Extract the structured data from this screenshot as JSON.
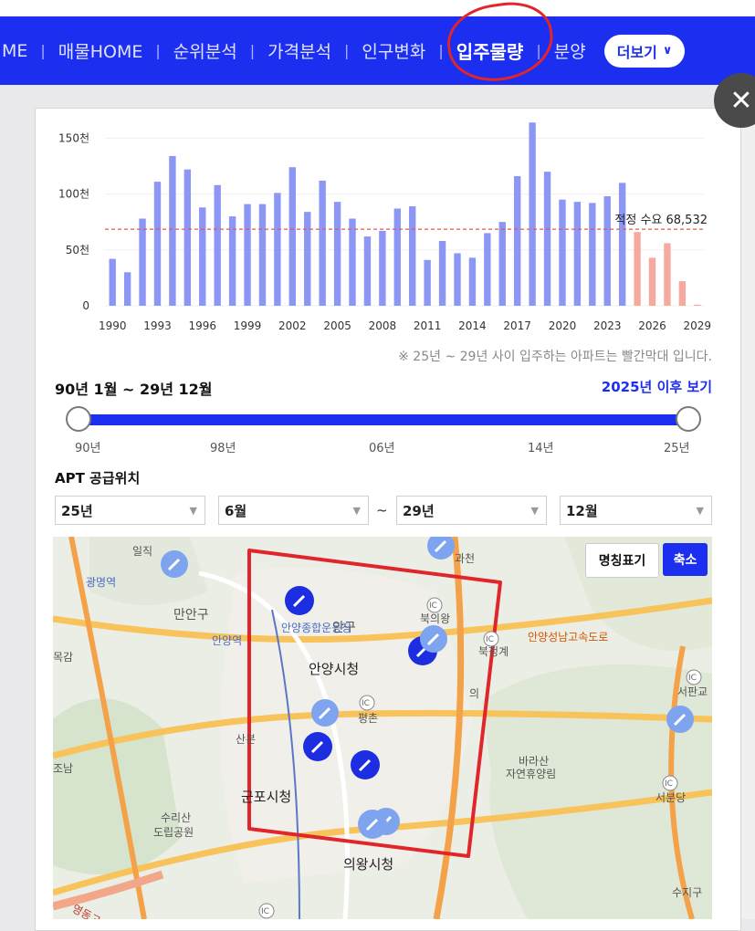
{
  "nav": {
    "items": [
      "ME",
      "매물HOME",
      "순위분석",
      "가격분석",
      "인구변화",
      "입주물량",
      "분양"
    ],
    "active_index": 5,
    "more_label": "더보기",
    "bg_color": "#1c2ef0"
  },
  "close_icon": "close-icon",
  "chart_data": {
    "type": "bar",
    "x": [
      1990,
      1991,
      1992,
      1993,
      1994,
      1995,
      1996,
      1997,
      1998,
      1999,
      2000,
      2001,
      2002,
      2003,
      2004,
      2005,
      2006,
      2007,
      2008,
      2009,
      2010,
      2011,
      2012,
      2013,
      2014,
      2015,
      2016,
      2017,
      2018,
      2019,
      2020,
      2021,
      2022,
      2023,
      2024,
      2025,
      2026,
      2027,
      2028,
      2029
    ],
    "values": [
      42,
      30,
      78,
      111,
      134,
      122,
      88,
      108,
      80,
      91,
      91,
      101,
      124,
      84,
      112,
      93,
      78,
      62,
      67,
      87,
      89,
      41,
      58,
      47,
      43,
      65,
      75,
      116,
      164,
      120,
      95,
      93,
      92,
      98,
      110,
      66,
      43,
      56,
      22,
      1
    ],
    "highlight_from": 2025,
    "bar_color": "#8c96f5",
    "highlight_color": "#f5aaa0",
    "ylim": [
      0,
      165
    ],
    "yticks": [
      0,
      50,
      100,
      150
    ],
    "ytick_labels": [
      "0",
      "50천",
      "100천",
      "150천"
    ],
    "xtick_labels": [
      "1990",
      "1993",
      "1996",
      "1999",
      "2002",
      "2005",
      "2008",
      "2011",
      "2014",
      "2017",
      "2020",
      "2023",
      "2026",
      "2029"
    ],
    "reference_line": {
      "value": 68532,
      "label": "적정 수요 68,532",
      "color": "#e05a4e"
    }
  },
  "chart_note": "※ 25년 ~ 29년 사이 입주하는 아파트는 빨간막대 입니다.",
  "range": {
    "title": "90년 1월 ~ 29년 12월",
    "after_link": "2025년 이후 보기",
    "ticks": [
      "90년",
      "98년",
      "06년",
      "14년",
      "25년"
    ],
    "value_start": "90년",
    "value_end": "25년"
  },
  "supply": {
    "title": "APT 공급위치",
    "from_year": "25년",
    "from_month": "6월",
    "tilde": "~",
    "to_year": "29년",
    "to_month": "12월"
  },
  "map": {
    "name_toggle": "명칭표기",
    "zoom_out": "축소",
    "labels": {
      "a1": "일직",
      "a2": "과천",
      "a3": "광명역",
      "a4": "만안구",
      "a5": "안양역",
      "a6": "안양종합운동장",
      "a7": "안구",
      "a8": "북의왕",
      "a9": "안양시청",
      "a10": "목감",
      "a11": "안양성남고속도로",
      "a12": "북청계",
      "a13": "서판교",
      "a14": "평촌",
      "a15": "산본",
      "a16": "의",
      "a17": "바라산",
      "a18": "자연휴양림",
      "a19": "군포시청",
      "a20": "서분당",
      "a21": "수리산",
      "a22": "도립공원",
      "a23": "의왕시청",
      "a24": "조남",
      "a25": "수지구",
      "a26": "영동고속도로",
      "ic": "IC"
    },
    "marker_icon": "hammer-icon"
  }
}
